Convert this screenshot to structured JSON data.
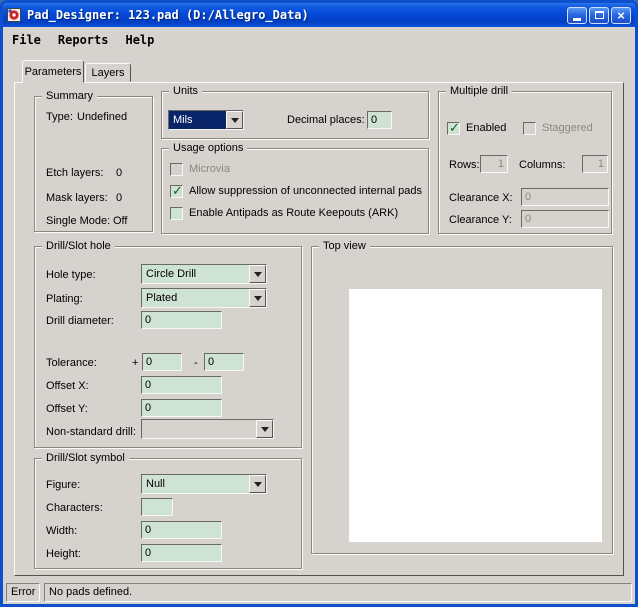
{
  "window": {
    "title": "Pad_Designer: 123.pad (D:/Allegro_Data)",
    "menu": {
      "file": "File",
      "reports": "Reports",
      "help": "Help"
    },
    "tabs": {
      "parameters": "Parameters",
      "layers": "Layers"
    }
  },
  "colors": {
    "titlebar_blue": "#0549d8",
    "panel_tan": "#d6d3ce",
    "field_green": "#cfe3d4",
    "selection_blue": "#0a246a",
    "check_green": "#176117"
  },
  "summary": {
    "title": "Summary",
    "type_label": "Type:",
    "type_value": "Undefined",
    "etch_label": "Etch layers:",
    "etch_value": "0",
    "mask_label": "Mask layers:",
    "mask_value": "0",
    "single_label": "Single Mode:",
    "single_value": "Off"
  },
  "units": {
    "title": "Units",
    "units_value": "Mils",
    "decimal_label": "Decimal places:",
    "decimal_value": "0"
  },
  "usage": {
    "title": "Usage options",
    "microvia": "Microvia",
    "suppression": "Allow suppression of unconnected internal pads",
    "antipads": "Enable Antipads as Route Keepouts (ARK)"
  },
  "multiple_drill": {
    "title": "Multiple drill",
    "enabled": "Enabled",
    "staggered": "Staggered",
    "rows_label": "Rows:",
    "rows_value": "1",
    "columns_label": "Columns:",
    "columns_value": "1",
    "clearance_x_label": "Clearance X:",
    "clearance_x_value": "0",
    "clearance_y_label": "Clearance Y:",
    "clearance_y_value": "0"
  },
  "hole": {
    "title": "Drill/Slot hole",
    "hole_type_label": "Hole type:",
    "hole_type_value": "Circle Drill",
    "plating_label": "Plating:",
    "plating_value": "Plated",
    "diameter_label": "Drill diameter:",
    "diameter_value": "0",
    "tolerance_label": "Tolerance:",
    "tolerance_plus_sign": "+",
    "tolerance_plus_value": "0",
    "tolerance_minus_sign": "-",
    "tolerance_minus_value": "0",
    "offset_x_label": "Offset X:",
    "offset_x_value": "0",
    "offset_y_label": "Offset Y:",
    "offset_y_value": "0",
    "nonstandard_label": "Non-standard drill:",
    "nonstandard_value": ""
  },
  "symbol": {
    "title": "Drill/Slot symbol",
    "figure_label": "Figure:",
    "figure_value": "Null",
    "characters_label": "Characters:",
    "characters_value": "",
    "width_label": "Width:",
    "width_value": "0",
    "height_label": "Height:",
    "height_value": "0"
  },
  "top_view": {
    "title": "Top view"
  },
  "status": {
    "error_label": "Error",
    "message": "No pads defined."
  }
}
